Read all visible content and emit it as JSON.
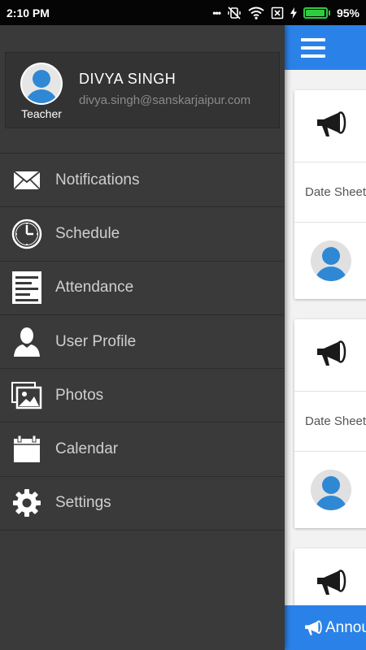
{
  "status_bar": {
    "time": "2:10 PM",
    "dots": "•••",
    "battery_percent": "95%",
    "battery_level": 0.95,
    "battery_color": "#2ecc40"
  },
  "colors": {
    "primary": "#2a82e8",
    "drawer_bg": "#3a3a3a",
    "avatar_blue": "#2f88d4"
  },
  "drawer": {
    "profile": {
      "name": "DIVYA SINGH",
      "email": "divya.singh@sanskarjaipur.com",
      "role": "Teacher",
      "avatar_icon": "user-avatar-icon"
    },
    "menu": [
      {
        "label": "Notifications",
        "icon": "envelope-icon"
      },
      {
        "label": "Schedule",
        "icon": "clock-icon"
      },
      {
        "label": "Attendance",
        "icon": "list-document-icon"
      },
      {
        "label": "User Profile",
        "icon": "user-silhouette-icon"
      },
      {
        "label": "Photos",
        "icon": "photos-icon"
      },
      {
        "label": "Calendar",
        "icon": "calendar-icon"
      },
      {
        "label": "Settings",
        "icon": "gear-icon"
      }
    ]
  },
  "main": {
    "menu_icon": "hamburger-menu-icon",
    "cards": [
      {
        "icon": "megaphone-icon",
        "text": "Date Sheet"
      },
      {
        "icon": "megaphone-icon",
        "text": "Date Sheet"
      },
      {
        "icon": "megaphone-icon",
        "text": ""
      }
    ],
    "bottom_button_label": "Announcement"
  }
}
